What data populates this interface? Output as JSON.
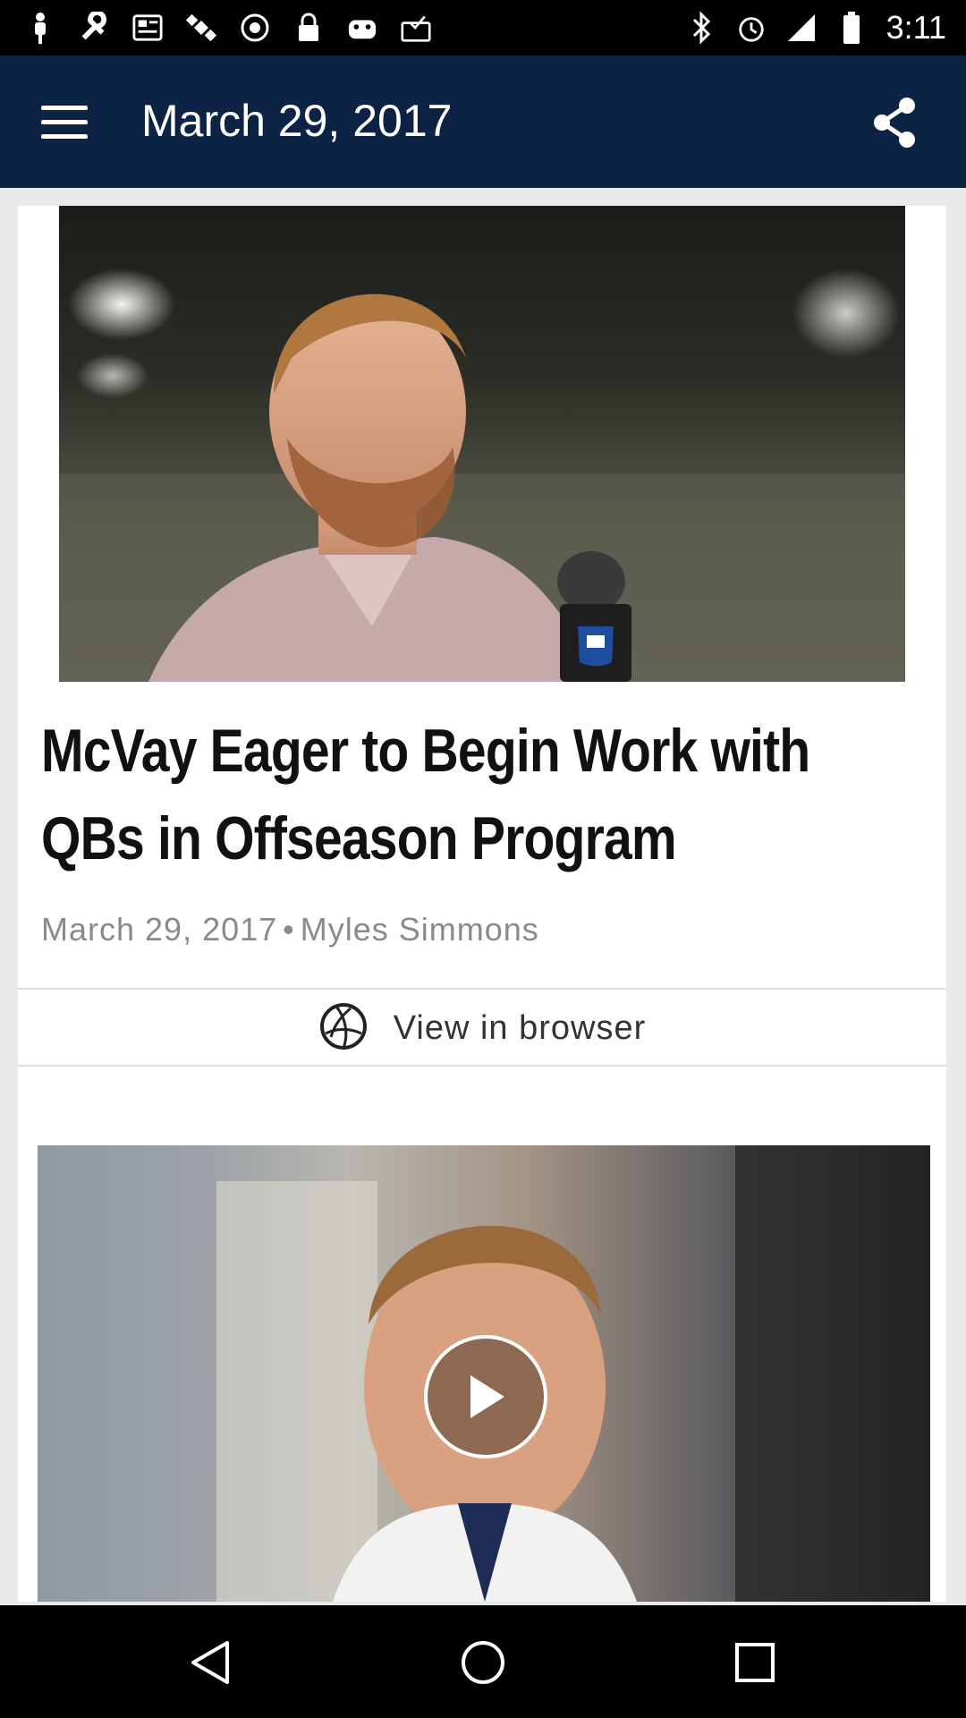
{
  "status_bar": {
    "time": "3:11",
    "left_icons": [
      "person-pin-icon",
      "wrench-icon",
      "news-icon",
      "satellite-icon",
      "blocked-icon",
      "lock-icon",
      "game-controller-icon",
      "inbox-check-icon"
    ],
    "right_icons": [
      "bluetooth-icon",
      "alarm-icon",
      "signal-icon",
      "battery-icon"
    ]
  },
  "app_bar": {
    "title": "March 29, 2017",
    "menu_icon": "hamburger-menu-icon",
    "share_icon": "share-icon",
    "background_color": "#0d2346"
  },
  "article": {
    "image_desc_icon": "photo",
    "headline": "McVay Eager to Begin Work with QBs in Offseason Program",
    "date": "March 29, 2017",
    "separator": "•",
    "author": "Myles Simmons",
    "view_in_browser_label": "View in browser",
    "browser_icon": "globe-icon",
    "video_play_icon": "play-icon"
  },
  "nav_bar": {
    "back_icon": "back-triangle-icon",
    "home_icon": "home-circle-icon",
    "recents_icon": "recents-square-icon"
  }
}
